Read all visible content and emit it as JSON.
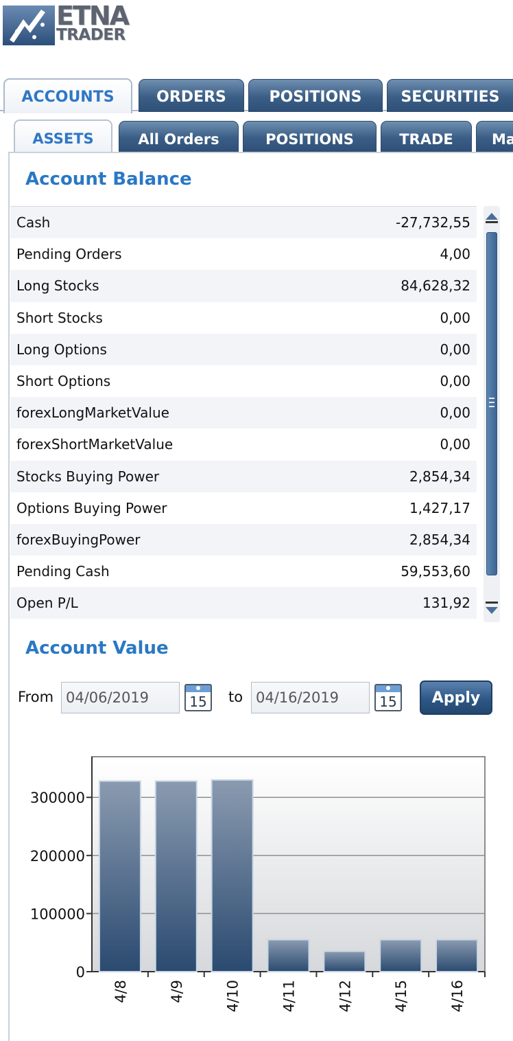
{
  "logo": {
    "line1": "ETNA",
    "line2": "TRADER"
  },
  "main_tabs": [
    {
      "label": "ACCOUNTS",
      "active": true
    },
    {
      "label": "ORDERS",
      "active": false
    },
    {
      "label": "POSITIONS",
      "active": false
    },
    {
      "label": "SECURITIES",
      "active": false
    }
  ],
  "sub_tabs": [
    {
      "label": "ASSETS",
      "active": true
    },
    {
      "label": "All Orders",
      "active": false
    },
    {
      "label": "POSITIONS",
      "active": false
    },
    {
      "label": "TRADE",
      "active": false
    },
    {
      "label": "Ma",
      "active": false
    }
  ],
  "balance": {
    "title": "Account Balance",
    "rows": [
      {
        "label": "Cash",
        "value": "-27,732,55"
      },
      {
        "label": "Pending Orders",
        "value": "4,00"
      },
      {
        "label": "Long Stocks",
        "value": "84,628,32"
      },
      {
        "label": "Short Stocks",
        "value": "0,00"
      },
      {
        "label": "Long Options",
        "value": "0,00"
      },
      {
        "label": "Short Options",
        "value": "0,00"
      },
      {
        "label": "forexLongMarketValue",
        "value": "0,00"
      },
      {
        "label": "forexShortMarketValue",
        "value": "0,00"
      },
      {
        "label": "Stocks Buying Power",
        "value": "2,854,34"
      },
      {
        "label": "Options Buying Power",
        "value": "1,427,17"
      },
      {
        "label": "forexBuyingPower",
        "value": "2,854,34"
      },
      {
        "label": "Pending Cash",
        "value": "59,553,60"
      },
      {
        "label": "Open P/L",
        "value": "131,92"
      }
    ]
  },
  "account_value": {
    "title": "Account Value",
    "from_label": "From",
    "from_value": "04/06/2019",
    "to_label": "to",
    "to_value": "04/16/2019",
    "calendar_day": "15",
    "apply_label": "Apply"
  },
  "colors": {
    "accent": "#2a78c4",
    "tab_dark": "#3b5e86",
    "bar_top": "#8a9bb0",
    "bar_bottom": "#2a4a70"
  },
  "chart_data": {
    "type": "bar",
    "categories": [
      "4/8",
      "4/9",
      "4/10",
      "4/11",
      "4/12",
      "4/15",
      "4/16"
    ],
    "values": [
      328000,
      328000,
      330000,
      55000,
      35000,
      55000,
      55000
    ],
    "ylim": [
      0,
      370000
    ],
    "yticks": [
      0,
      100000,
      200000,
      300000
    ],
    "grid": true
  }
}
